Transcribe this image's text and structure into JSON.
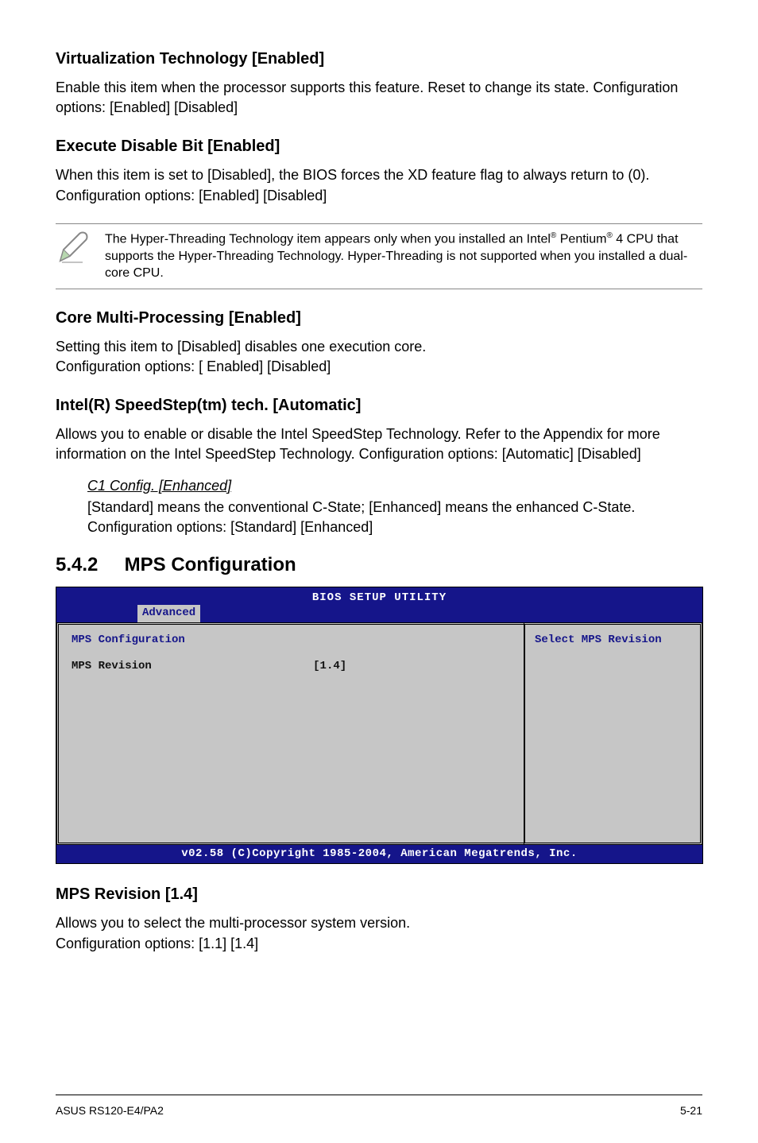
{
  "sec1": {
    "heading": "Virtualization Technology [Enabled]",
    "body": "Enable this item when the processor supports this feature. Reset to change its state. Configuration options: [Enabled] [Disabled]"
  },
  "sec2": {
    "heading": "Execute Disable Bit [Enabled]",
    "body": "When this item is set to [Disabled], the BIOS forces the XD feature flag to always return to (0). Configuration options: [Enabled] [Disabled]"
  },
  "note": {
    "pre": "The Hyper-Threading Technology item appears only when you installed an Intel",
    "mid": " Pentium",
    "post": " 4 CPU that supports the Hyper-Threading Technology. Hyper-Threading is not supported when you installed a dual-core CPU."
  },
  "sec3": {
    "heading": "Core Multi-Processing [Enabled]",
    "body1": "Setting this item to [Disabled] disables one execution core.",
    "body2": "Configuration options: [ Enabled] [Disabled]"
  },
  "sec4": {
    "heading": "Intel(R) SpeedStep(tm) tech. [Automatic]",
    "body": "Allows you to enable or disable the Intel SpeedStep Technology. Refer to the Appendix for more information on the Intel SpeedStep Technology. Configuration options: [Automatic] [Disabled]"
  },
  "sub": {
    "title": "C1 Config. [Enhanced]",
    "body": "[Standard] means the conventional C-State; [Enhanced] means the enhanced C-State. Configuration options: [Standard] [Enhanced]"
  },
  "section542": {
    "num": "5.4.2",
    "title": "MPS Configuration"
  },
  "bios": {
    "title": "BIOS SETUP UTILITY",
    "tab": "Advanced",
    "cfg_label": "MPS Configuration",
    "row_label": "MPS Revision",
    "row_value": "[1.4]",
    "help": "Select MPS Revision",
    "footer": "v02.58 (C)Copyright 1985-2004, American Megatrends, Inc."
  },
  "sec5": {
    "heading": "MPS Revision [1.4]",
    "body1": "Allows you to select the multi-processor system version.",
    "body2": "Configuration options: [1.1] [1.4]"
  },
  "footer": {
    "left": "ASUS RS120-E4/PA2",
    "right": "5-21"
  }
}
